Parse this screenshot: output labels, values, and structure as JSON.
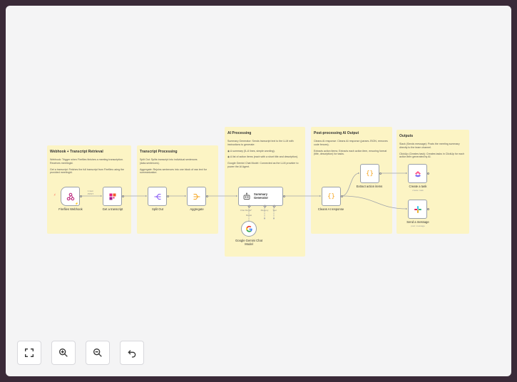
{
  "notes": [
    {
      "id": "webhook",
      "title": "Webhook + Transcript Retrieval",
      "lines": [
        "Webhook: Trigger when Fireflies finishes a meeting transcription. Receives meetingId.",
        "Get a transcript: Fetches the full transcript from Fireflies using the provided meetingId."
      ]
    },
    {
      "id": "transcript",
      "title": "Transcript Processing",
      "lines": [
        "Split Out: Splits transcript into individual sentences (data.sentences).",
        "Aggregate: Rejoins sentences into one block of raw text for summarization."
      ]
    },
    {
      "id": "ai",
      "title": "AI Processing",
      "lines": [
        "Summary Generator: Sends transcript text to the LLM with instructions to generate:",
        "◉ A summary (5–6 lines, simple wording).",
        "◉ A list of action items (each with a short title and description).",
        "Google Gemini Chat Model: Connected as the LLM provider to power the AI Agent."
      ]
    },
    {
      "id": "post",
      "title": "Post-processing AI Output",
      "lines": [
        "Cleans AI response: Cleans AI response (parses JSON, removes code fences).",
        "Extracts action items: Extracts each action item, ensuring format (title, description) for tasks."
      ]
    },
    {
      "id": "outputs",
      "title": "Outputs",
      "lines": [
        "Slack (Sends message): Posts the meeting summary directly to the team channel.",
        "ClickUp (Creates task): Creates tasks in ClickUp for each action item generated by AI."
      ]
    }
  ],
  "nodes": {
    "fireflies_webhook": {
      "label": "Fireflies Webhook"
    },
    "get_transcript": {
      "label": "Get a transcript"
    },
    "split_out": {
      "label": "Split Out"
    },
    "aggregate": {
      "label": "Aggregate"
    },
    "summary_generator": {
      "label": "Summary Generator"
    },
    "gemini": {
      "label": "Google Gemini Chat Model"
    },
    "cleans_ai_response": {
      "label": "Cleans AI response"
    },
    "extract_action_items": {
      "label": "Extract action items"
    },
    "create_task": {
      "label": "Create a task",
      "sub": "create: task"
    },
    "send_message": {
      "label": "Send a message",
      "sub": "post: message"
    }
  },
  "edge_labels": {
    "webhook_items": "1 item\nPOST"
  },
  "ports": {
    "chat_model": "Chat Model*",
    "memory": "Memory",
    "tool": "Tool",
    "model": "Model"
  },
  "controls": [
    {
      "id": "fit",
      "icon": "fit-view-icon"
    },
    {
      "id": "zoom-in",
      "icon": "zoom-in-icon"
    },
    {
      "id": "zoom-out",
      "icon": "zoom-out-icon"
    },
    {
      "id": "undo",
      "icon": "undo-icon"
    }
  ],
  "colors": {
    "background": "#3a2a38",
    "canvas": "#f4f4f5",
    "note": "#fcf4c4",
    "edge": "#a0a4aa",
    "accent": "#ff6d5a"
  }
}
